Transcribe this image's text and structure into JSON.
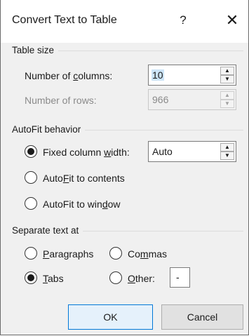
{
  "dialog": {
    "title": "Convert Text to Table",
    "help_glyph": "?",
    "close_glyph": "✕"
  },
  "table_size": {
    "heading": "Table size",
    "columns": {
      "label_pre": "Number of ",
      "label_accel": "c",
      "label_post": "olumns:",
      "value": "10"
    },
    "rows": {
      "label": "Number of rows:",
      "value": "966"
    }
  },
  "autofit": {
    "heading": "AutoFit behavior",
    "fixed": {
      "label_pre": "Fixed column ",
      "label_accel": "w",
      "label_post": "idth:",
      "value": "Auto",
      "selected": true
    },
    "contents": {
      "label_pre": "Auto",
      "label_accel": "F",
      "label_post": "it to contents",
      "selected": false
    },
    "window": {
      "label_pre": "AutoFit to win",
      "label_accel": "d",
      "label_post": "ow",
      "selected": false
    }
  },
  "separate": {
    "heading": "Separate text at",
    "paragraphs": {
      "label_pre": "",
      "label_accel": "P",
      "label_post": "aragraphs",
      "selected": false
    },
    "commas": {
      "label_pre": "Co",
      "label_accel": "m",
      "label_post": "mas",
      "selected": false
    },
    "tabs": {
      "label_pre": "",
      "label_accel": "T",
      "label_post": "abs",
      "selected": true
    },
    "other": {
      "label_pre": "",
      "label_accel": "O",
      "label_post": "ther:",
      "selected": false,
      "value": "-"
    }
  },
  "buttons": {
    "ok": "OK",
    "cancel": "Cancel"
  },
  "icons": {
    "spin_up": "▲",
    "spin_down": "▼"
  },
  "colors": {
    "dialog_bg": "#f0f0f0",
    "title_bg": "#ffffff",
    "ok_border": "#0078d7",
    "selection": "#cce4f7"
  }
}
